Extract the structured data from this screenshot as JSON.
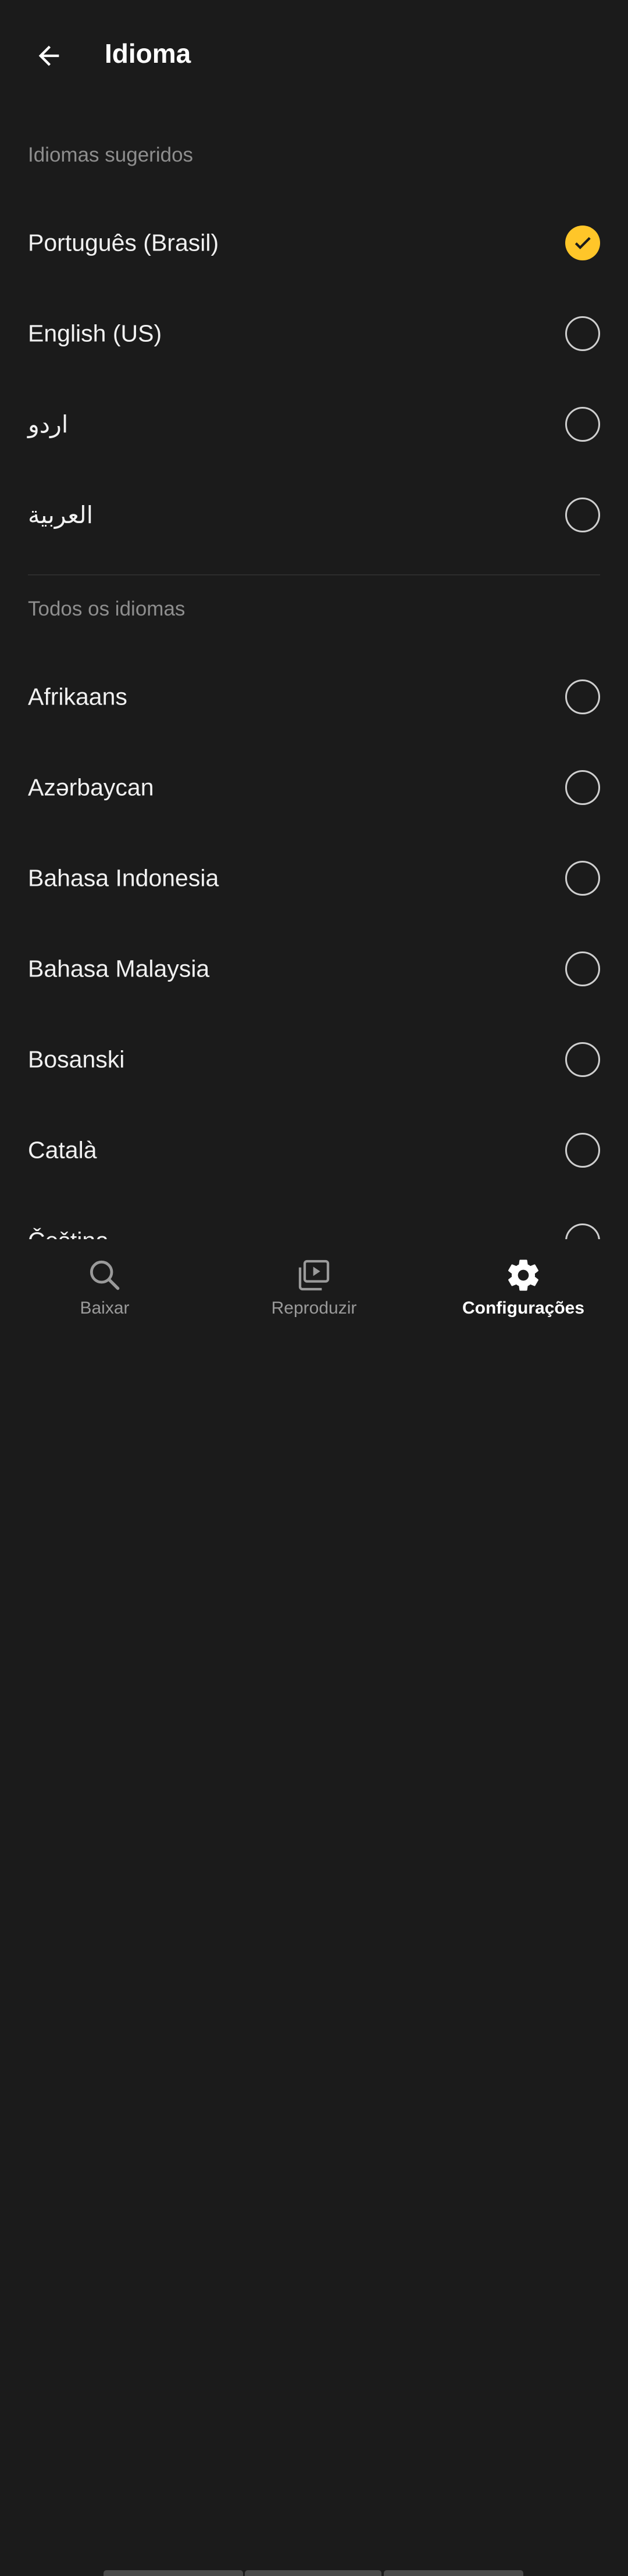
{
  "header": {
    "back_icon": "arrow-left-icon",
    "title": "Idioma"
  },
  "sections": {
    "suggested": {
      "title": "Idiomas sugeridos",
      "items": [
        {
          "label": "Português (Brasil)",
          "selected": true
        },
        {
          "label": "English (US)",
          "selected": false
        },
        {
          "label": "اردو",
          "selected": false
        },
        {
          "label": "العربية",
          "selected": false
        }
      ]
    },
    "all": {
      "title": "Todos os idiomas",
      "items": [
        {
          "label": "Afrikaans",
          "selected": false
        },
        {
          "label": "Azərbaycan",
          "selected": false
        },
        {
          "label": "Bahasa Indonesia",
          "selected": false
        },
        {
          "label": "Bahasa Malaysia",
          "selected": false
        },
        {
          "label": "Bosanski",
          "selected": false
        },
        {
          "label": "Català",
          "selected": false
        },
        {
          "label": "Čeština",
          "selected": false
        }
      ]
    }
  },
  "bottom_nav": {
    "items": [
      {
        "label": "Baixar",
        "icon": "search-icon",
        "active": false
      },
      {
        "label": "Reproduzir",
        "icon": "play-library-icon",
        "active": false
      },
      {
        "label": "Configurações",
        "icon": "gear-icon",
        "active": true
      }
    ]
  },
  "colors": {
    "background": "#1b1b1b",
    "accent": "#ffc629",
    "section_header": "#8e8e8e",
    "inactive_nav": "#9a9a9a"
  }
}
